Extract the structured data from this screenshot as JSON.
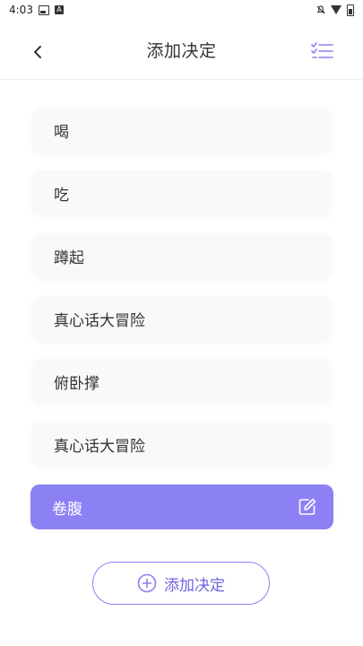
{
  "status_bar": {
    "time": "4:03"
  },
  "header": {
    "title": "添加决定"
  },
  "items": [
    {
      "label": "喝"
    },
    {
      "label": "吃"
    },
    {
      "label": "蹲起"
    },
    {
      "label": "真心话大冒险"
    },
    {
      "label": "俯卧撑"
    },
    {
      "label": "真心话大冒险"
    },
    {
      "label": "卷腹"
    }
  ],
  "add_button": {
    "label": "添加决定"
  },
  "colors": {
    "accent": "#8b80f4",
    "accent_text": "#6f65e0",
    "item_bg": "#f9f9fb"
  },
  "icons": {
    "back": "chevron-left-icon",
    "list": "checklist-icon",
    "edit": "edit-icon",
    "add": "plus-circle-icon"
  }
}
